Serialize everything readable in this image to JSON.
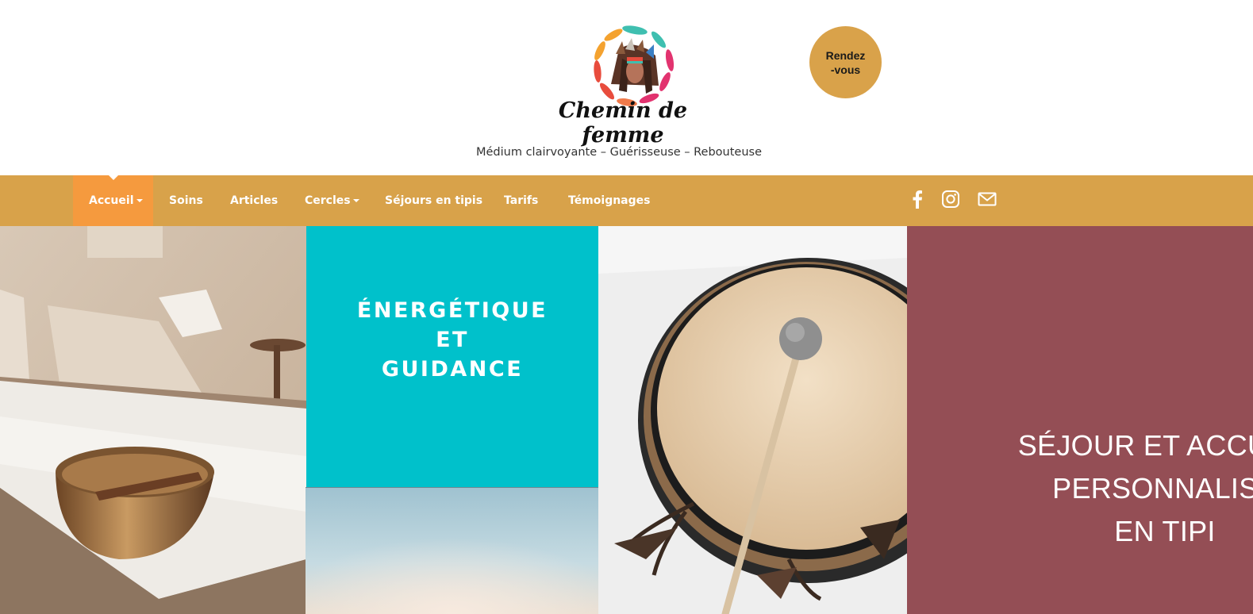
{
  "brand": {
    "logo_text": "Chemin de femme",
    "tagline": "Médium clairvoyante – Guérisseuse – Rebouteuse"
  },
  "header": {
    "rdv_button": {
      "line1": "Rendez",
      "line2": "-vous"
    }
  },
  "nav": {
    "items": [
      {
        "label": "Accueil",
        "dropdown": true,
        "active": true
      },
      {
        "label": "Soins",
        "dropdown": false
      },
      {
        "label": "Articles",
        "dropdown": false
      },
      {
        "label": "Cercles",
        "dropdown": true
      },
      {
        "label": "Séjours en tipis",
        "dropdown": false
      },
      {
        "label": "Tarifs",
        "dropdown": false
      },
      {
        "label": "Témoignages",
        "dropdown": false
      }
    ],
    "social_icons": [
      "facebook-icon",
      "instagram-icon",
      "mail-icon"
    ]
  },
  "tiles": {
    "energetique": {
      "lines": [
        "ÉNERGÉTIQUE",
        "ET",
        "GUIDANCE"
      ]
    },
    "sejour": {
      "lines": [
        "SÉJOUR ET ACCUEIL",
        "PERSONNALISÉ",
        "EN TIPI"
      ]
    }
  },
  "colors": {
    "nav_bg": "#d8a24a",
    "nav_active": "#f59a3e",
    "rdv_bg": "#d9a24a",
    "tile_teal": "#00c1cb",
    "tile_burgundy": "#944e55"
  }
}
